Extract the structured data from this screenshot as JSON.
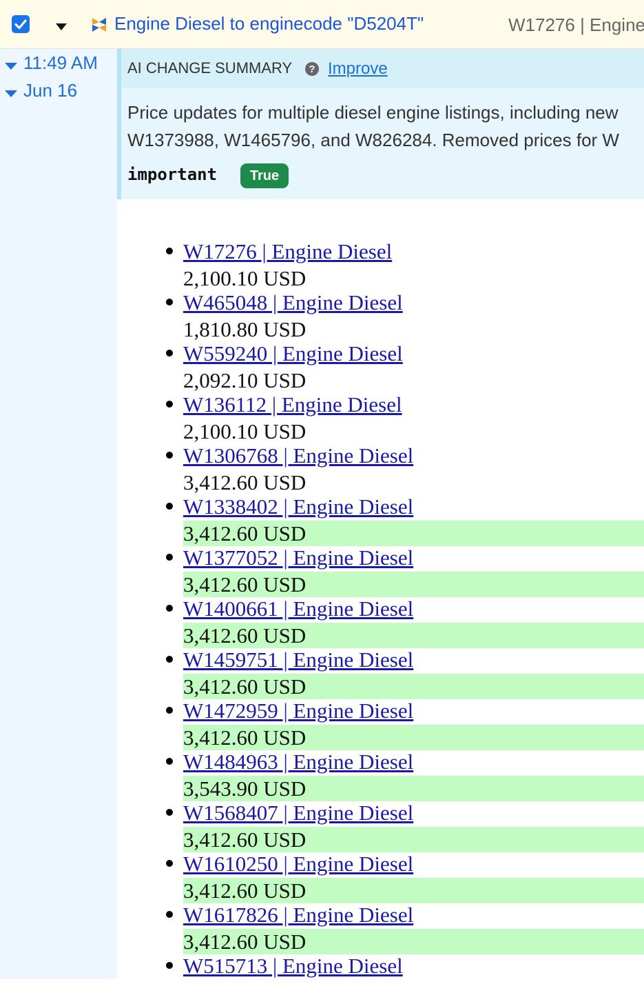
{
  "header": {
    "title": "Engine Diesel to enginecode \"D5204T\"",
    "right_text": "W17276 | Engine"
  },
  "sidebar": {
    "time": "11:49 AM",
    "date": "Jun 16"
  },
  "summary": {
    "label": "AI CHANGE SUMMARY",
    "improve_label": "Improve",
    "text_line1": "Price updates for multiple diesel engine listings, including new",
    "text_line2": "W1373988, W1465796, and W826284. Removed prices for W",
    "important_label": "important",
    "important_value": "True"
  },
  "items": [
    {
      "link": "W17276 | Engine Diesel",
      "price": "2,100.10 USD",
      "changed": false
    },
    {
      "link": "W465048 | Engine Diesel",
      "price": "1,810.80 USD",
      "changed": false
    },
    {
      "link": "W559240 | Engine Diesel",
      "price": "2,092.10 USD",
      "changed": false
    },
    {
      "link": "W136112 | Engine Diesel",
      "price": "2,100.10 USD",
      "changed": false
    },
    {
      "link": "W1306768 | Engine Diesel",
      "price": "3,412.60 USD",
      "changed": false
    },
    {
      "link": "W1338402 | Engine Diesel",
      "price": "3,412.60 USD",
      "changed": true
    },
    {
      "link": "W1377052 | Engine Diesel",
      "price": "3,412.60 USD",
      "changed": true
    },
    {
      "link": "W1400661 | Engine Diesel",
      "price": "3,412.60 USD",
      "changed": true
    },
    {
      "link": "W1459751 | Engine Diesel",
      "price": "3,412.60 USD",
      "changed": true
    },
    {
      "link": "W1472959 | Engine Diesel",
      "price": "3,412.60 USD",
      "changed": true
    },
    {
      "link": "W1484963 | Engine Diesel",
      "price": "3,543.90 USD",
      "changed": true
    },
    {
      "link": "W1568407 | Engine Diesel",
      "price": "3,412.60 USD",
      "changed": true
    },
    {
      "link": "W1610250 | Engine Diesel",
      "price": "3,412.60 USD",
      "changed": true
    },
    {
      "link": "W1617826 | Engine Diesel",
      "price": "3,412.60 USD",
      "changed": true
    },
    {
      "link": "W515713 | Engine Diesel",
      "price": "",
      "changed": false
    }
  ],
  "colors": {
    "accent": "#1a6fd8",
    "added_highlight": "#c2fcc2",
    "badge_green": "#1e8a4c"
  }
}
